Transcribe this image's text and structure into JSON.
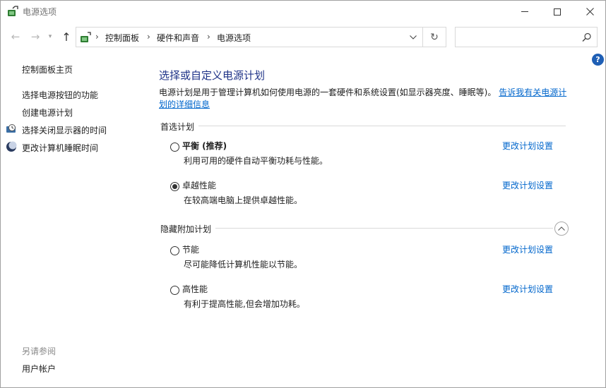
{
  "window": {
    "title": "电源选项"
  },
  "address": {
    "crumbs": [
      "控制面板",
      "硬件和声音",
      "电源选项"
    ],
    "separator": "›"
  },
  "search": {
    "placeholder": ""
  },
  "left_panel": {
    "home": "控制面板主页",
    "links": [
      "选择电源按钮的功能",
      "创建电源计划",
      "选择关闭显示器的时间",
      "更改计算机睡眠时间"
    ],
    "see_also_label": "另请参阅",
    "see_also_links": [
      "用户帐户"
    ]
  },
  "main": {
    "title": "选择或自定义电源计划",
    "description": "电源计划是用于管理计算机如何使用电源的一套硬件和系统设置(如显示器亮度、睡眠等)。",
    "description_link": "告诉我有关电源计划的详细信息",
    "preferred_label": "首选计划",
    "hidden_label": "隐藏附加计划",
    "change_link": "更改计划设置",
    "preferred_plans": [
      {
        "name": "平衡 (推荐)",
        "desc": "利用可用的硬件自动平衡功耗与性能。",
        "selected": false
      },
      {
        "name": "卓越性能",
        "desc": "在较高端电脑上提供卓越性能。",
        "selected": true
      }
    ],
    "hidden_plans": [
      {
        "name": "节能",
        "desc": "尽可能降低计算机性能以节能。",
        "selected": false
      },
      {
        "name": "高性能",
        "desc": "有利于提高性能,但会增加功耗。",
        "selected": false
      }
    ]
  },
  "icons": {
    "window": "power-options-icon",
    "back": "back-arrow-icon",
    "forward": "forward-arrow-icon",
    "recent": "chevron-down-icon",
    "up": "up-arrow-icon",
    "refresh": "refresh-icon",
    "search": "search-icon",
    "help": "help-icon",
    "collapse": "chevron-up-icon"
  },
  "colors": {
    "title": "#1e3287",
    "link": "#0066cc",
    "help": "#1f5fb5"
  }
}
